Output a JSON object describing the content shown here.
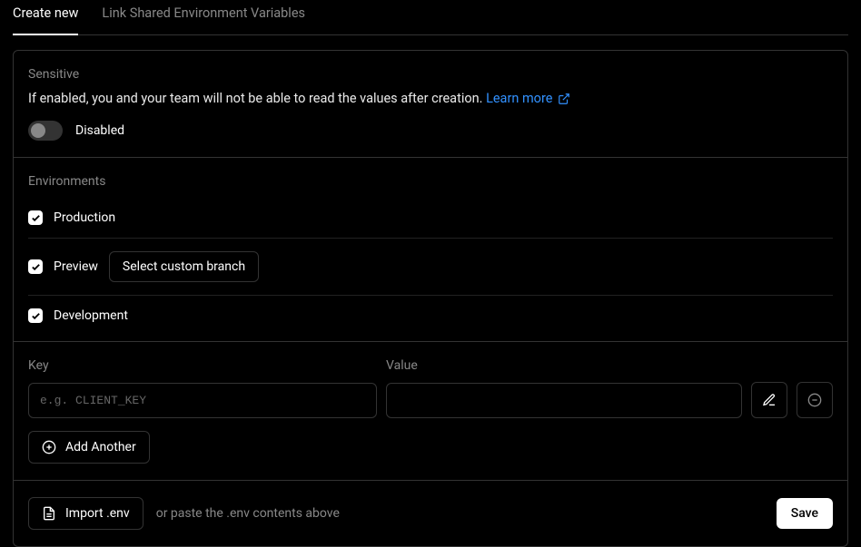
{
  "tabs": {
    "create": "Create new",
    "link": "Link Shared Environment Variables"
  },
  "sensitive": {
    "label": "Sensitive",
    "description": "If enabled, you and your team will not be able to read the values after creation.",
    "learn_more": "Learn more",
    "state": "Disabled"
  },
  "environments": {
    "label": "Environments",
    "items": [
      {
        "name": "Production",
        "checked": true
      },
      {
        "name": "Preview",
        "checked": true
      },
      {
        "name": "Development",
        "checked": true
      }
    ],
    "branch_button": "Select custom branch"
  },
  "kv": {
    "key_label": "Key",
    "value_label": "Value",
    "key_placeholder": "e.g. CLIENT_KEY",
    "key_value": "",
    "value_value": "",
    "add_another": "Add Another"
  },
  "footer": {
    "import": "Import .env",
    "hint": "or paste the .env contents above",
    "save": "Save"
  }
}
